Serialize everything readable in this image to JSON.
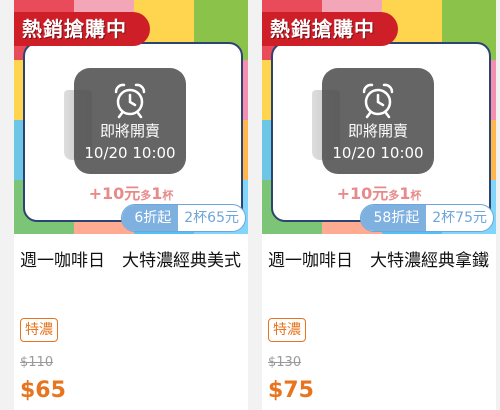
{
  "products": [
    {
      "ribbon": "熱銷搶購中",
      "overlay_label": "即將開賣",
      "overlay_time": "10/20 10:00",
      "promo_prefix": "+10元",
      "promo_mid": "多",
      "promo_num": "1",
      "promo_suffix": "杯",
      "discount": "6折起",
      "bundle": "2杯65元",
      "title": "週一咖啡日　大特濃經典美式",
      "tag": "特濃",
      "original_price": "$110",
      "price": "$65",
      "icon": "alarm-clock-icon"
    },
    {
      "ribbon": "熱銷搶購中",
      "overlay_label": "即將開賣",
      "overlay_time": "10/20 10:00",
      "promo_prefix": "+10元",
      "promo_mid": "多",
      "promo_num": "1",
      "promo_suffix": "杯",
      "discount": "58折起",
      "bundle": "2杯75元",
      "title": "週一咖啡日　大特濃經典拿鐵",
      "tag": "特濃",
      "original_price": "$130",
      "price": "$75",
      "icon": "alarm-clock-icon"
    }
  ],
  "colors": {
    "ribbon": "#ce1f28",
    "accent": "#e8741e",
    "pill": "#7fb1e0",
    "frame": "#2c4472"
  }
}
